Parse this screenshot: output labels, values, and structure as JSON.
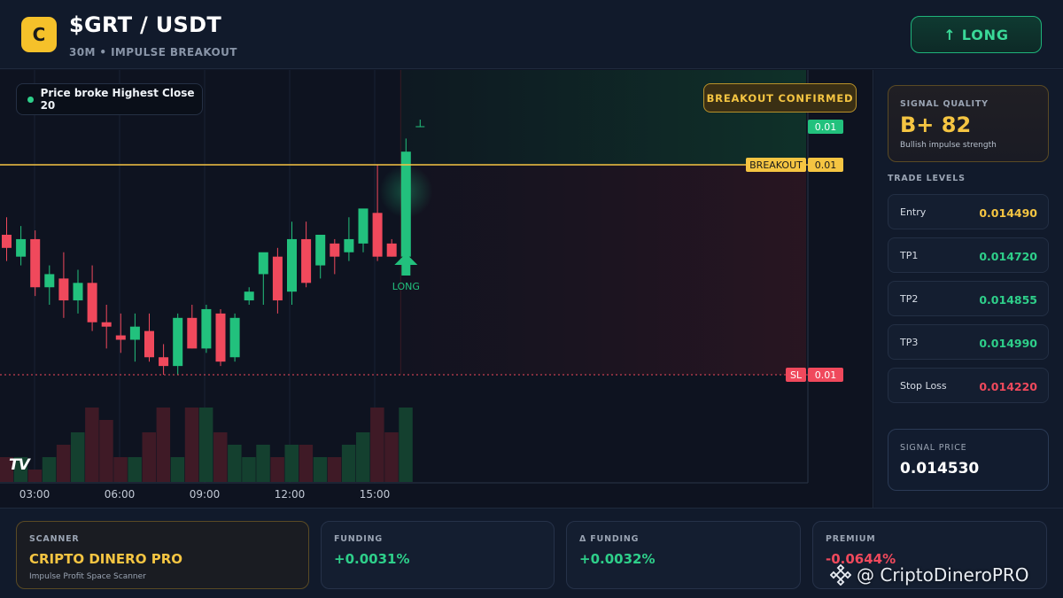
{
  "header": {
    "logo_letter": "C",
    "pair": "$GRT / USDT",
    "subtitle": "30M • IMPULSE BREAKOUT",
    "direction_button": "↑ LONG"
  },
  "chart": {
    "info_pill": "Price broke Highest Close 20",
    "confirm_badge": "BREAKOUT CONFIRMED",
    "breakout_label": "BREAKOUT",
    "sl_label": "SL",
    "long_label": "LONG",
    "tv_logo": "TV",
    "colors": {
      "up": "#22c17d",
      "down": "#f0495c",
      "breakout": "#f5c542",
      "sl": "#f0495c"
    }
  },
  "chart_data": {
    "type": "candlestick",
    "x_ticks": [
      "03:00",
      "06:00",
      "09:00",
      "12:00",
      "15:00"
    ],
    "price_tags": [
      "0.01",
      "0.01",
      "0.01"
    ],
    "levels": {
      "breakout": 0.01446,
      "stop_loss": 0.01422
    },
    "candles": [
      {
        "o": 0.01438,
        "h": 0.0144,
        "l": 0.01435,
        "c": 0.014365
      },
      {
        "o": 0.014355,
        "h": 0.01439,
        "l": 0.014345,
        "c": 0.014375
      },
      {
        "o": 0.014375,
        "h": 0.014385,
        "l": 0.01431,
        "c": 0.01432
      },
      {
        "o": 0.01432,
        "h": 0.014345,
        "l": 0.0143,
        "c": 0.014335
      },
      {
        "o": 0.01433,
        "h": 0.01436,
        "l": 0.014285,
        "c": 0.014305
      },
      {
        "o": 0.014305,
        "h": 0.01434,
        "l": 0.01429,
        "c": 0.014325
      },
      {
        "o": 0.014325,
        "h": 0.014345,
        "l": 0.01427,
        "c": 0.01428
      },
      {
        "o": 0.01428,
        "h": 0.0143,
        "l": 0.01425,
        "c": 0.014275
      },
      {
        "o": 0.014265,
        "h": 0.01429,
        "l": 0.014245,
        "c": 0.01426
      },
      {
        "o": 0.01426,
        "h": 0.01429,
        "l": 0.014235,
        "c": 0.014275
      },
      {
        "o": 0.01427,
        "h": 0.01429,
        "l": 0.014235,
        "c": 0.01424
      },
      {
        "o": 0.01424,
        "h": 0.014255,
        "l": 0.01422,
        "c": 0.01423
      },
      {
        "o": 0.01423,
        "h": 0.01429,
        "l": 0.01422,
        "c": 0.014285
      },
      {
        "o": 0.014285,
        "h": 0.0143,
        "l": 0.01425,
        "c": 0.01425
      },
      {
        "o": 0.01425,
        "h": 0.0143,
        "l": 0.014245,
        "c": 0.014295
      },
      {
        "o": 0.01429,
        "h": 0.014295,
        "l": 0.01423,
        "c": 0.014235
      },
      {
        "o": 0.01424,
        "h": 0.01429,
        "l": 0.014235,
        "c": 0.014285
      },
      {
        "o": 0.014305,
        "h": 0.01432,
        "l": 0.0143,
        "c": 0.014315
      },
      {
        "o": 0.014335,
        "h": 0.014355,
        "l": 0.0143,
        "c": 0.01436
      },
      {
        "o": 0.014355,
        "h": 0.014365,
        "l": 0.01429,
        "c": 0.014305
      },
      {
        "o": 0.014315,
        "h": 0.014395,
        "l": 0.0143,
        "c": 0.014375
      },
      {
        "o": 0.014375,
        "h": 0.014395,
        "l": 0.01432,
        "c": 0.014325
      },
      {
        "o": 0.014345,
        "h": 0.01438,
        "l": 0.01433,
        "c": 0.01438
      },
      {
        "o": 0.01437,
        "h": 0.014375,
        "l": 0.014335,
        "c": 0.014355
      },
      {
        "o": 0.01436,
        "h": 0.0144,
        "l": 0.01435,
        "c": 0.014375
      },
      {
        "o": 0.01437,
        "h": 0.014385,
        "l": 0.01436,
        "c": 0.01441
      },
      {
        "o": 0.014405,
        "h": 0.01446,
        "l": 0.01435,
        "c": 0.014355
      },
      {
        "o": 0.01437,
        "h": 0.014375,
        "l": 0.014355,
        "c": 0.014355
      },
      {
        "o": 0.014355,
        "h": 0.01449,
        "l": 0.01435,
        "c": 0.014475
      }
    ],
    "volumes": [
      2,
      2,
      1,
      2,
      3,
      4,
      6,
      5,
      2,
      2,
      4,
      6,
      2,
      6,
      6,
      4,
      3,
      2,
      3,
      2,
      3,
      3,
      2,
      2,
      3,
      4,
      6,
      4,
      6
    ]
  },
  "signal_quality": {
    "label": "SIGNAL QUALITY",
    "grade": "B+ 82",
    "note": "Bullish impulse strength"
  },
  "trade_levels": {
    "title": "TRADE LEVELS",
    "items": [
      {
        "name": "Entry",
        "price": "0.014490",
        "color": "#f5c542"
      },
      {
        "name": "TP1",
        "price": "0.014720",
        "color": "#2ecf8a"
      },
      {
        "name": "TP2",
        "price": "0.014855",
        "color": "#2ecf8a"
      },
      {
        "name": "TP3",
        "price": "0.014990",
        "color": "#2ecf8a"
      },
      {
        "name": "Stop Loss",
        "price": "0.014220",
        "color": "#f0495c"
      }
    ]
  },
  "signal_price": {
    "label": "SIGNAL PRICE",
    "value": "0.014530"
  },
  "bottom": {
    "scanner": {
      "label": "SCANNER",
      "value": "CRIPTO DINERO PRO",
      "note": "Impulse Profit Space Scanner",
      "color": "#f5c542"
    },
    "funding": {
      "label": "FUNDING",
      "value": "+0.0031%",
      "color": "#2ecf8a"
    },
    "delta_funding": {
      "label": "Δ FUNDING",
      "value": "+0.0032%",
      "color": "#2ecf8a"
    },
    "premium": {
      "label": "PREMIUM",
      "value": "-0.0644%",
      "color": "#f0495c"
    }
  },
  "watermark": "@ CriptoDineroPRO"
}
